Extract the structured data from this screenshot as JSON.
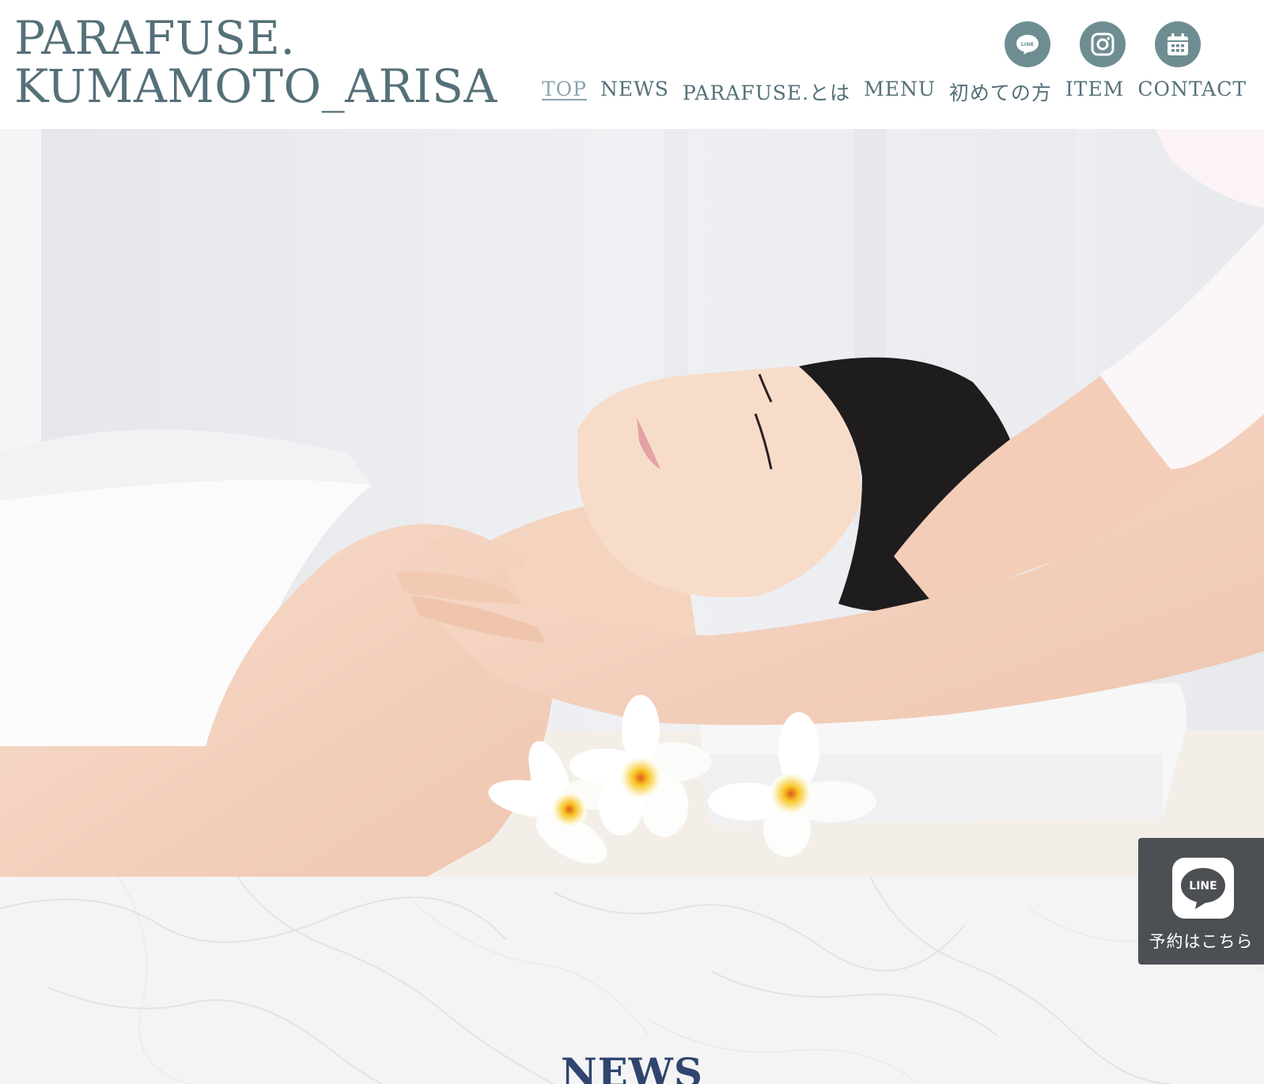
{
  "site": {
    "logo_line1": "PARAFUSE.",
    "logo_line2": "KUMAMOTO_ARISA"
  },
  "social": {
    "items": [
      {
        "icon": "line-icon",
        "label": "LINE"
      },
      {
        "icon": "instagram-icon"
      },
      {
        "icon": "calendar-icon"
      }
    ]
  },
  "nav": {
    "items": [
      {
        "label": "TOP",
        "active": true
      },
      {
        "label": "NEWS"
      },
      {
        "label": "PARAFUSE.とは"
      },
      {
        "label": "MENU"
      },
      {
        "label": "初めての方"
      },
      {
        "label": "ITEM"
      },
      {
        "label": "CONTACT"
      }
    ]
  },
  "hero": {
    "image": "spa-massage-photo"
  },
  "news": {
    "title": "NEWS"
  },
  "line_widget": {
    "badge_text": "LINE",
    "label": "予約はこちら"
  },
  "colors": {
    "brand": "#557079",
    "icon_bg": "#6e8d93",
    "nav_active": "#8aa6ad",
    "news_title": "#2f456e",
    "widget_bg": "#4c4f53"
  }
}
